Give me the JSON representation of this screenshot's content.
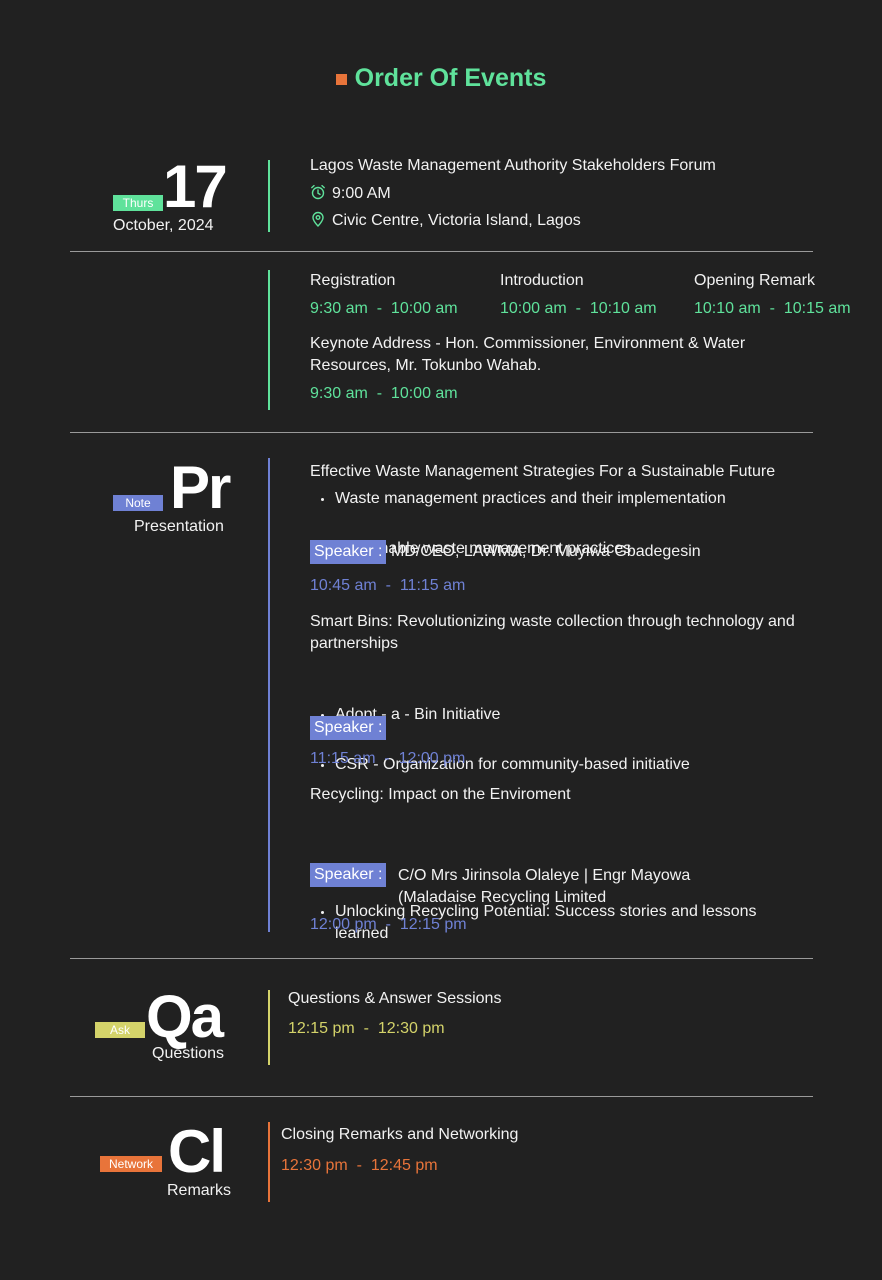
{
  "header": {
    "title": "Order Of Events"
  },
  "colors": {
    "green": "#5fe29b",
    "blue": "#6f81d4",
    "yellow": "#d4d36a",
    "orange": "#e8743a",
    "background": "#212121"
  },
  "event": {
    "tag": "Thurs",
    "day": "17",
    "month_year": "October, 2024",
    "name": "Lagos Waste Management Authority Stakeholders Forum",
    "time": "9:00 AM",
    "time_icon": "alarm-clock-icon",
    "venue": "Civic Centre, Victoria Island, Lagos",
    "venue_icon": "location-pin-icon"
  },
  "opening": {
    "items": [
      {
        "label": "Registration",
        "start": "9:30 am",
        "end": "10:00 am"
      },
      {
        "label": "Introduction",
        "start": "10:00 am",
        "end": "10:10 am"
      },
      {
        "label": "Opening Remark",
        "start": "10:10 am",
        "end": "10:15 am"
      }
    ],
    "keynote": {
      "label": "Keynote Address - Hon. Commissioner, Environment & Water Resources, Mr. Tokunbo Wahab.",
      "start": "9:30 am",
      "end": "10:00 am"
    }
  },
  "presentation": {
    "tag": "Note",
    "symbol": "Pr",
    "label": "Presentation",
    "speaker_label": "Speaker :",
    "talks": [
      {
        "title": "Effective Waste Management Strategies For a Sustainable Future",
        "bullets": [
          "Waste management practices and their implementation",
          "Sustainable waste management practices"
        ],
        "speaker": "MD/CEO, LAWMA, Dr. Muyiwa Gbadegesin",
        "start": "10:45 am",
        "end": "11:15 am"
      },
      {
        "title": "Smart Bins: Revolutionizing waste collection through technology and partnerships",
        "bullets": [
          "Adopt - a - Bin Initiative",
          "CSR - Organization for community-based initiative"
        ],
        "speaker": "",
        "start": "11:15 am",
        "end": "12:00 pm"
      },
      {
        "title": "Recycling: Impact on the Enviroment",
        "bullets": [
          "Unlocking Recycling Potential: Success stories and lessons learned"
        ],
        "speaker": "C/O Mrs Jirinsola Olaleye | Engr Mayowa (Maladaise Recycling Limited",
        "start": "12:00 pm",
        "end": "12:15 pm"
      }
    ]
  },
  "questions": {
    "tag": "Ask",
    "symbol": "Qa",
    "label": "Questions",
    "title": "Questions & Answer Sessions",
    "start": "12:15 pm",
    "end": "12:30 pm"
  },
  "closing": {
    "tag": "Network",
    "symbol": "Cl",
    "label": "Remarks",
    "title": "Closing Remarks and Networking",
    "start": "12:30 pm",
    "end": "12:45 pm"
  },
  "time_separator": "-"
}
